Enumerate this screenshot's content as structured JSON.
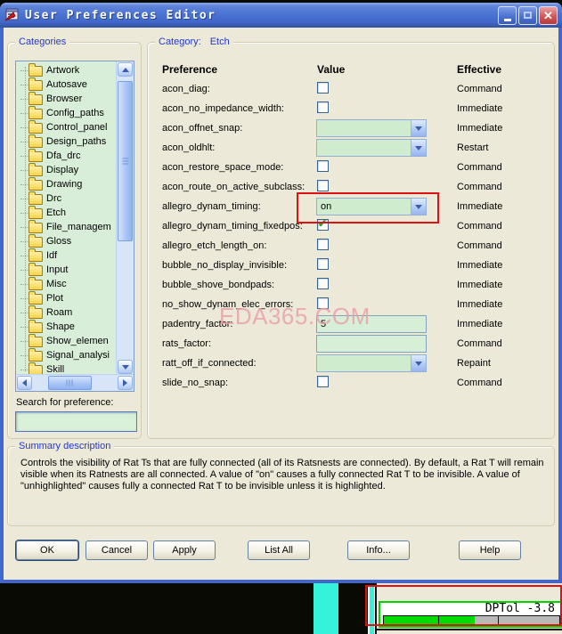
{
  "window": {
    "title": "User Preferences Editor"
  },
  "icons": {
    "close_glyph": "✕",
    "check_glyph": "✔"
  },
  "categories": {
    "label": "Categories",
    "items": [
      "Artwork",
      "Autosave",
      "Browser",
      "Config_paths",
      "Control_panel",
      "Design_paths",
      "Dfa_drc",
      "Display",
      "Drawing",
      "Drc",
      "Etch",
      "File_managem",
      "Gloss",
      "Idf",
      "Input",
      "Misc",
      "Plot",
      "Roam",
      "Shape",
      "Show_elemen",
      "Signal_analysi",
      "Skill"
    ]
  },
  "search": {
    "label": "Search for preference:",
    "value": ""
  },
  "prefs": {
    "category_label": "Category:",
    "category_value": "Etch",
    "headers": {
      "preference": "Preference",
      "value": "Value",
      "effective": "Effective"
    },
    "rows": [
      {
        "label": "acon_diag:",
        "type": "checkbox",
        "checked": false,
        "effective": "Command"
      },
      {
        "label": "acon_no_impedance_width:",
        "type": "checkbox",
        "checked": false,
        "effective": "Immediate"
      },
      {
        "label": "acon_offnet_snap:",
        "type": "combo",
        "value": "",
        "effective": "Immediate"
      },
      {
        "label": "acon_oldhlt:",
        "type": "combo",
        "value": "",
        "effective": "Restart"
      },
      {
        "label": "acon_restore_space_mode:",
        "type": "checkbox",
        "checked": false,
        "effective": "Command"
      },
      {
        "label": "acon_route_on_active_subclass:",
        "type": "checkbox",
        "checked": false,
        "effective": "Command"
      },
      {
        "label": "allegro_dynam_timing:",
        "type": "combo",
        "value": "on",
        "effective": "Immediate",
        "highlighted": true
      },
      {
        "label": "allegro_dynam_timing_fixedpos:",
        "type": "checkbox",
        "checked": true,
        "effective": "Command"
      },
      {
        "label": "allegro_etch_length_on:",
        "type": "checkbox",
        "checked": false,
        "effective": "Command"
      },
      {
        "label": "bubble_no_display_invisible:",
        "type": "checkbox",
        "checked": false,
        "effective": "Immediate"
      },
      {
        "label": "bubble_shove_bondpads:",
        "type": "checkbox",
        "checked": false,
        "effective": "Immediate"
      },
      {
        "label": "no_show_dynam_elec_errors:",
        "type": "checkbox",
        "checked": false,
        "effective": "Immediate"
      },
      {
        "label": "padentry_factor:",
        "type": "text",
        "value": "5",
        "effective": "Immediate"
      },
      {
        "label": "rats_factor:",
        "type": "text",
        "value": "",
        "effective": "Command"
      },
      {
        "label": "ratt_off_if_connected:",
        "type": "combo",
        "value": "",
        "effective": "Repaint"
      },
      {
        "label": "slide_no_snap:",
        "type": "checkbox",
        "checked": false,
        "effective": "Command"
      }
    ]
  },
  "summary": {
    "label": "Summary description",
    "text": "Controls the visibility of Rat Ts that are fully connected (all of its Ratsnests are connected).  By default,  a Rat T will remain visible when its Ratnests are all connected.  A value of \"on\" causes a fully connected Rat T to be invisible.  A value of \"unhighlighted\" causes fully a connected Rat T to be invisible unless it is highlighted."
  },
  "buttons": [
    "OK",
    "Cancel",
    "Apply",
    "List All",
    "Info...",
    "Help"
  ],
  "watermark": "EDA365.COM",
  "status_fragment": {
    "label": "DPTol -3.8",
    "green_fraction": 0.52,
    "dividers": [
      0.31,
      0.65
    ]
  },
  "colors": {
    "highlight_red": "#dd1111",
    "field_green": "#d6efd6",
    "tree_green": "#d9eed9",
    "titlebar_blue": "#4a72d1",
    "cyan": "#35f2da",
    "progress_green": "#00dc00"
  }
}
